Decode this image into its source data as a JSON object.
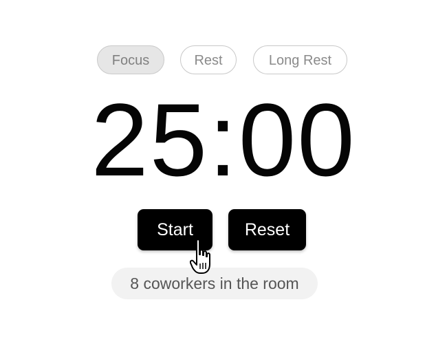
{
  "modes": {
    "focus_label": "Focus",
    "rest_label": "Rest",
    "long_rest_label": "Long Rest",
    "active": "Focus"
  },
  "timer": {
    "display": "25:00"
  },
  "controls": {
    "start_label": "Start",
    "reset_label": "Reset"
  },
  "room": {
    "status_text": "8 coworkers in the room"
  },
  "cursor": {
    "icon": "hand-pointer-icon"
  },
  "colors": {
    "button_bg": "#000000",
    "button_text": "#ffffff",
    "active_tab_bg": "#e6e6e6",
    "pill_bg": "#f2f2f2"
  }
}
